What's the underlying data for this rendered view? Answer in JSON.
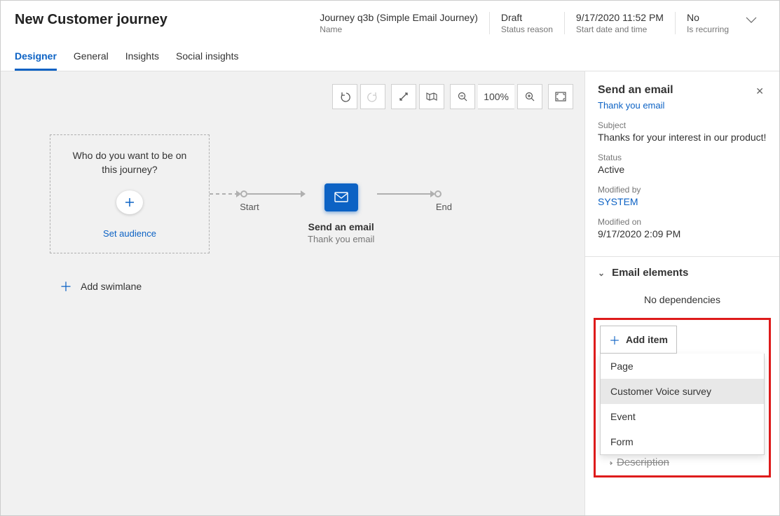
{
  "header": {
    "title": "New Customer journey",
    "meta": [
      {
        "value": "Journey q3b (Simple Email Journey)",
        "label": "Name"
      },
      {
        "value": "Draft",
        "label": "Status reason"
      },
      {
        "value": "9/17/2020 11:52 PM",
        "label": "Start date and time"
      },
      {
        "value": "No",
        "label": "Is recurring"
      }
    ]
  },
  "tabs": [
    "Designer",
    "General",
    "Insights",
    "Social insights"
  ],
  "toolbar": {
    "zoom": "100%"
  },
  "canvas": {
    "audience_question": "Who do you want to be on this journey?",
    "set_audience": "Set audience",
    "start": "Start",
    "end": "End",
    "email_node": {
      "title": "Send an email",
      "subtitle": "Thank you email"
    },
    "add_swimlane": "Add swimlane"
  },
  "panel": {
    "title": "Send an email",
    "subtitle": "Thank you email",
    "subject_label": "Subject",
    "subject_value": "Thanks for your interest in our product!",
    "status_label": "Status",
    "status_value": "Active",
    "modified_by_label": "Modified by",
    "modified_by_value": "SYSTEM",
    "modified_on_label": "Modified on",
    "modified_on_value": "9/17/2020 2:09 PM",
    "elements_section": "Email elements",
    "no_dependencies": "No dependencies",
    "add_item": "Add item",
    "dropdown": [
      "Page",
      "Customer Voice survey",
      "Event",
      "Form"
    ],
    "description_section": "Description"
  }
}
